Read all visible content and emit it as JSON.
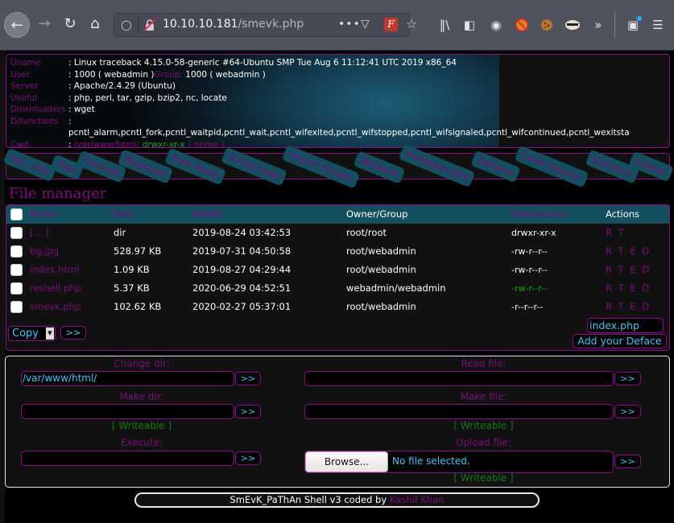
{
  "browser": {
    "url_host": "10.10.10.181",
    "url_path": "/smevk.php",
    "icons": [
      "back-icon",
      "forward-icon",
      "reload-icon",
      "home-icon",
      "shield-icon",
      "insecure-lock-icon",
      "more-icon",
      "pocket-icon",
      "extension-icon",
      "bookmark-star-icon",
      "library-icon",
      "sidebar-icon",
      "account-icon",
      "cookie-blocker-icon",
      "cookie-icon",
      "badger-icon",
      "overflow-icon",
      "gift-icon",
      "menu-icon"
    ]
  },
  "info": {
    "rows": [
      {
        "label": "Uname",
        "value": ": Linux traceback 4.15.0-58-generic #64-Ubuntu SMP Tue Aug 6 11:12:41 UTC 2019 x86_64"
      },
      {
        "label": "User",
        "value": ": 1000 ( webadmin ) ",
        "extra_label": "Group:",
        "extra_value": " 1000 ( webadmin )"
      },
      {
        "label": "Server",
        "value": ": Apache/2.4.29 (Ubuntu)"
      },
      {
        "label": "Useful",
        "value": ": php, perl, tar, gzip, bzip2, nc, locate"
      },
      {
        "label": "Downloaders",
        "value": ": wget"
      },
      {
        "label": "D/functions",
        "value": ":"
      },
      {
        "label": "",
        "value": "pcntl_alarm,pcntl_fork,pcntl_waitpid,pcntl_wait,pcntl_wifexited,pcntl_wifstopped,pcntl_wifsignaled,pcntl_wifcontinued,pcntl_wexitsta"
      }
    ],
    "cwd_label": "Cwd",
    "cwd_sep": ": ",
    "cwd_path": "/var/www/html/",
    "cwd_perm": "drwxr-xr-x",
    "cwd_home": "[ home ]"
  },
  "nav": {
    "tabs": [
      "Sec. Info",
      "Files",
      "Console",
      "Bypasser",
      "Safe Mode",
      "String tools",
      "Import Scripts",
      "Network",
      "Readable Dirs",
      "Defacer",
      "Code Injector",
      "Domains",
      "Logout"
    ]
  },
  "file_manager": {
    "title": "File manager",
    "columns": [
      "Name",
      "Size",
      "Modify",
      "Owner/Group",
      "Permissions",
      "Actions"
    ],
    "rows": [
      {
        "name": "[ .. ]",
        "size": "dir",
        "modify": "2019-08-24 03:42:53",
        "owner": "root/root",
        "perms": "drwxr-xr-x",
        "perms_color": "#ffffff",
        "actions": "R T"
      },
      {
        "name": "bg.jpg",
        "size": "528.97 KB",
        "modify": "2019-07-31 04:50:58",
        "owner": "root/webadmin",
        "perms": "-rw-r--r--",
        "perms_color": "#ffffff",
        "actions": "R T E D"
      },
      {
        "name": "index.html",
        "size": "1.09 KB",
        "modify": "2019-08-27 04:29:44",
        "owner": "root/webadmin",
        "perms": "-rw-r--r--",
        "perms_color": "#ffffff",
        "actions": "R T E D"
      },
      {
        "name": "reshell.php",
        "size": "5.37 KB",
        "modify": "2020-06-29 04:52:51",
        "owner": "webadmin/webadmin",
        "perms": "-rw-r--r--",
        "perms_color": "#1fa11f",
        "actions": "R T E D"
      },
      {
        "name": "smevk.php",
        "size": "102.62 KB",
        "modify": "2020-02-27 05:37:01",
        "owner": "root/webadmin",
        "perms": "-r--r--r--",
        "perms_color": "#ffffff",
        "actions": "R T E D"
      }
    ],
    "bulk_action_selected": "Copy",
    "go_label": ">>",
    "deface_file": "index.php",
    "deface_button": "Add your Deface"
  },
  "tools": {
    "change_dir": {
      "label": "Change dir:",
      "value": "/var/www/html/"
    },
    "read_file": {
      "label": "Read file:",
      "value": ""
    },
    "make_dir": {
      "label": "Make dir:",
      "value": "",
      "status": "[ Writeable ]"
    },
    "make_file": {
      "label": "Make file:",
      "value": "",
      "status": "[ Writeable ]"
    },
    "execute": {
      "label": "Execute:",
      "value": ""
    },
    "upload": {
      "label": "Upload file:",
      "browse": "Browse...",
      "file_status": "No file selected.",
      "status": "[ Writeable ]"
    },
    "go_label": ">>"
  },
  "footer": {
    "text": "SmEvK_PaThAn Shell v3 coded by ",
    "author": "Kashif Khan"
  },
  "colors": {
    "accent_purple": "#7a0e7a",
    "border_purple": "#8b0d8b",
    "teal": "#134f5e",
    "input_text": "#4fc3e8",
    "writeable_green": "#137a13"
  }
}
